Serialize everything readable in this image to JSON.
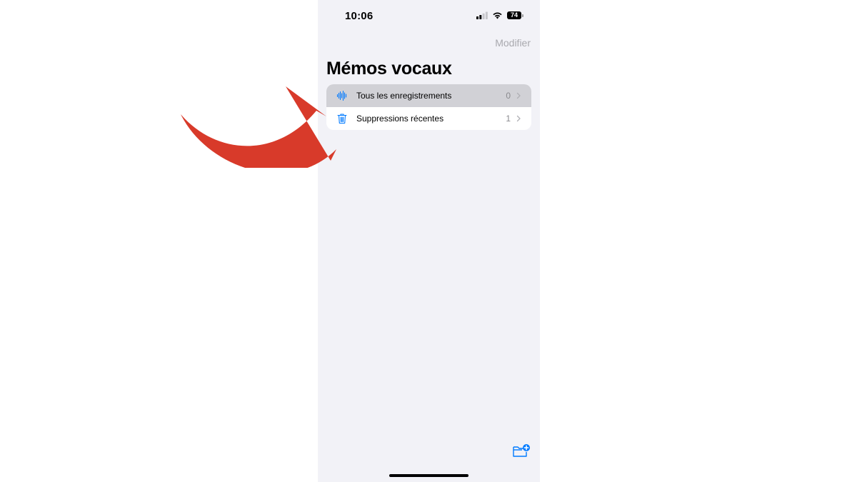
{
  "status_bar": {
    "time": "10:06",
    "battery": "74"
  },
  "header": {
    "edit_label": "Modifier",
    "title": "Mémos vocaux"
  },
  "folders": [
    {
      "label": "Tous les enregistrements",
      "count": "0",
      "icon": "waveform-icon",
      "selected": true
    },
    {
      "label": "Suppressions récentes",
      "count": "1",
      "icon": "trash-icon",
      "selected": false
    }
  ],
  "toolbar": {
    "new_folder_icon": "folder-plus-icon"
  },
  "colors": {
    "accent": "#007aff",
    "background": "#f2f2f7",
    "selected_row": "#d1d1d6",
    "annotation": "#d83a2a"
  }
}
